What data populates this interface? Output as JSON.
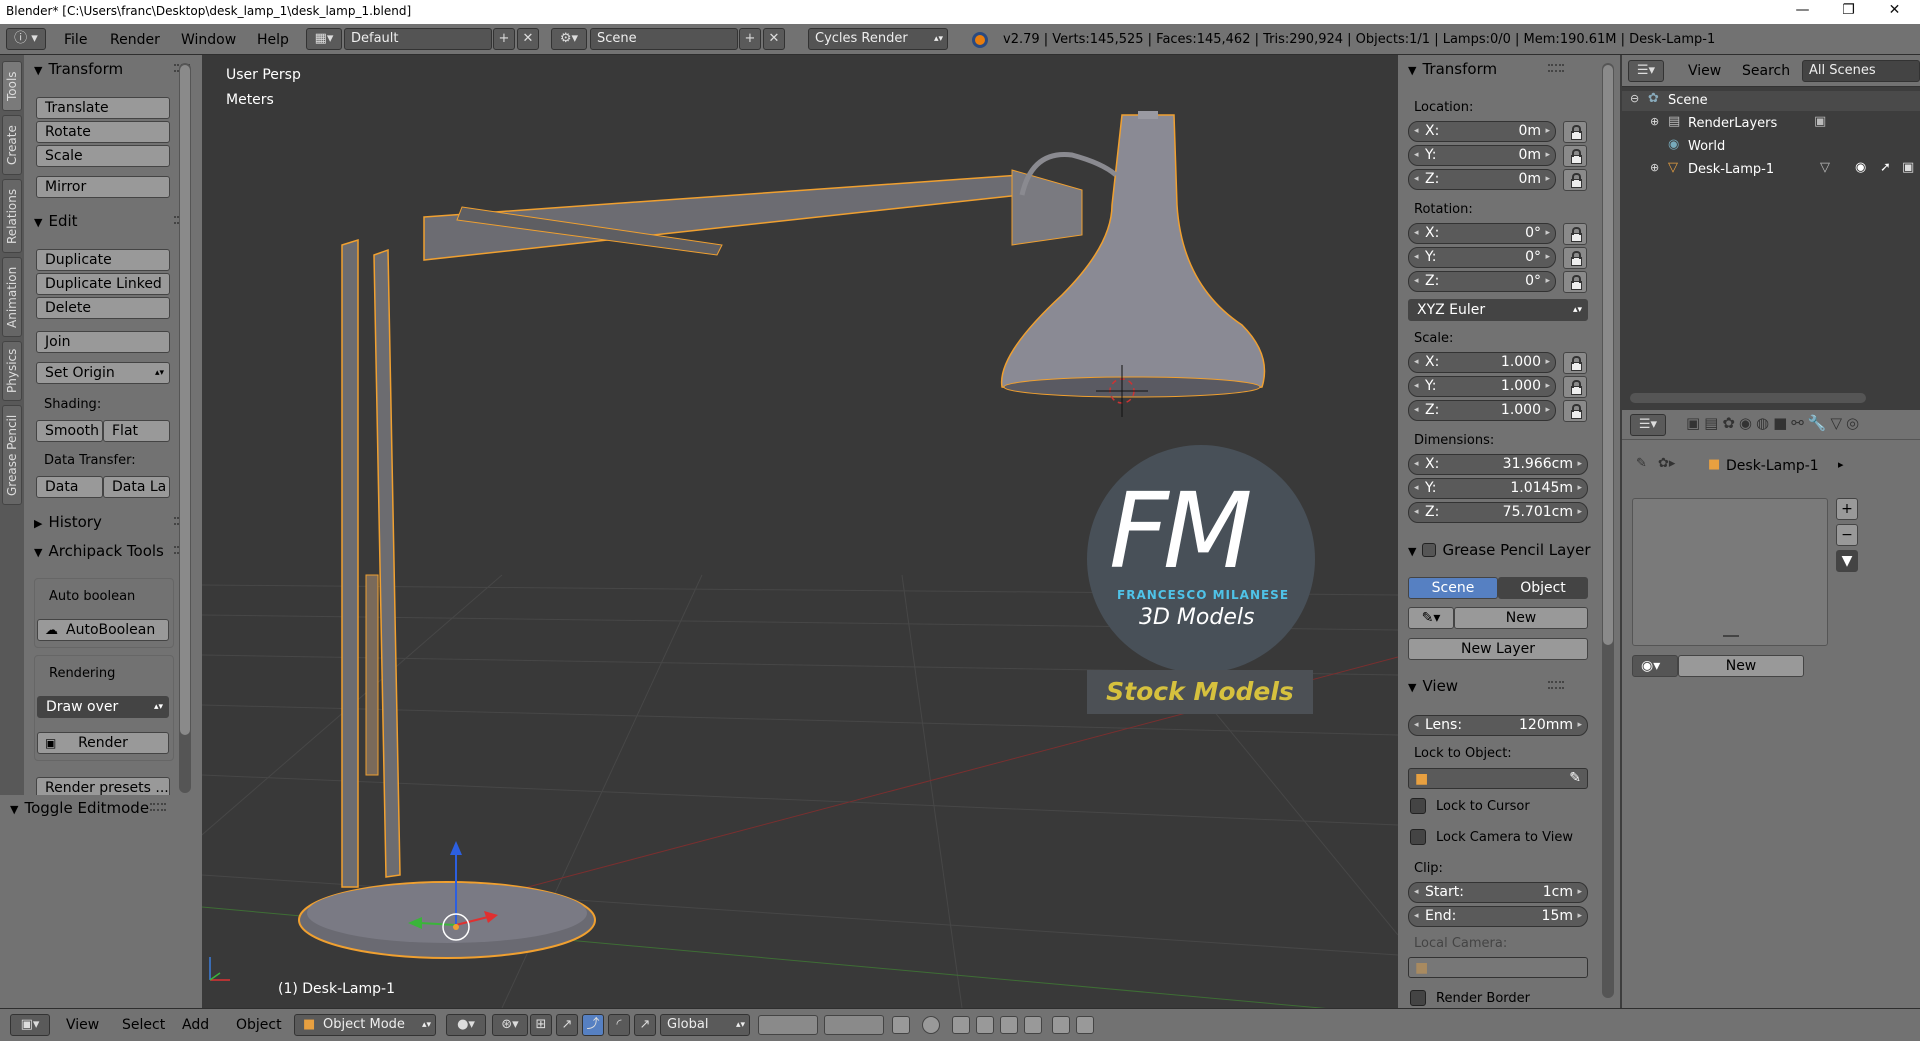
{
  "window": {
    "title": "Blender* [C:\\Users\\franc\\Desktop\\desk_lamp_1\\desk_lamp_1.blend]",
    "minimize": "—",
    "maximize": "❐",
    "close": "✕"
  },
  "infobar": {
    "menus": [
      "File",
      "Render",
      "Window",
      "Help"
    ],
    "layout": "Default",
    "scene": "Scene",
    "engine": "Cycles Render",
    "stats": "v2.79 | Verts:145,525 | Faces:145,462 | Tris:290,924 | Objects:1/1 | Lamps:0/0 | Mem:190.61M | Desk-Lamp-1"
  },
  "toolshelf": {
    "tabs": [
      "Tools",
      "Create",
      "Relations",
      "Animation",
      "Physics",
      "Grease Pencil"
    ],
    "transform": {
      "title": "Transform",
      "translate": "Translate",
      "rotate": "Rotate",
      "scale": "Scale",
      "mirror": "Mirror"
    },
    "edit": {
      "title": "Edit",
      "duplicate": "Duplicate",
      "duplicate_linked": "Duplicate Linked",
      "delete": "Delete",
      "join": "Join",
      "set_origin": "Set Origin",
      "shading_label": "Shading:",
      "smooth": "Smooth",
      "flat": "Flat",
      "data_transfer_label": "Data Transfer:",
      "data": "Data",
      "data_la": "Data La"
    },
    "history": "History",
    "archipack": {
      "title": "Archipack Tools",
      "auto_boolean_label": "Auto boolean",
      "auto_boolean_btn": "AutoBoolean",
      "rendering_label": "Rendering",
      "draw_over": "Draw over",
      "render": "Render",
      "render_presets": "Render presets ..."
    },
    "toggle_editmode": "Toggle Editmode"
  },
  "viewport": {
    "view_name": "User Persp",
    "units": "Meters",
    "object_label": "(1) Desk-Lamp-1",
    "watermark": {
      "letters": "FM",
      "name": "FRANCESCO MILANESE",
      "sub": "3D Models",
      "banner": "Stock Models"
    }
  },
  "npanel": {
    "transform_title": "Transform",
    "location_label": "Location:",
    "location": [
      {
        "axis": "X:",
        "value": "0m"
      },
      {
        "axis": "Y:",
        "value": "0m"
      },
      {
        "axis": "Z:",
        "value": "0m"
      }
    ],
    "rotation_label": "Rotation:",
    "rotation": [
      {
        "axis": "X:",
        "value": "0°"
      },
      {
        "axis": "Y:",
        "value": "0°"
      },
      {
        "axis": "Z:",
        "value": "0°"
      }
    ],
    "rotation_mode": "XYZ Euler",
    "scale_label": "Scale:",
    "scale": [
      {
        "axis": "X:",
        "value": "1.000"
      },
      {
        "axis": "Y:",
        "value": "1.000"
      },
      {
        "axis": "Z:",
        "value": "1.000"
      }
    ],
    "dimensions_label": "Dimensions:",
    "dimensions": [
      {
        "axis": "X:",
        "value": "31.966cm"
      },
      {
        "axis": "Y:",
        "value": "1.0145m"
      },
      {
        "axis": "Z:",
        "value": "75.701cm"
      }
    ],
    "grease_title": "Grease Pencil Layer",
    "gp_scene": "Scene",
    "gp_object": "Object",
    "gp_new": "New",
    "gp_new_layer": "New Layer",
    "view_title": "View",
    "lens_label": "Lens:",
    "lens_value": "120mm",
    "lock_to_object": "Lock to Object:",
    "lock_to_cursor": "Lock to Cursor",
    "lock_camera": "Lock Camera to View",
    "clip_label": "Clip:",
    "clip_start_label": "Start:",
    "clip_start": "1cm",
    "clip_end_label": "End:",
    "clip_end": "15m",
    "local_camera": "Local Camera:",
    "render_border": "Render Border"
  },
  "outliner": {
    "view": "View",
    "search": "Search",
    "filter": "All Scenes",
    "items": [
      "Scene",
      "RenderLayers",
      "World",
      "Desk-Lamp-1"
    ]
  },
  "properties": {
    "breadcrumb": "Desk-Lamp-1",
    "new": "New"
  },
  "bottombar": {
    "menus": [
      "View",
      "Select",
      "Add",
      "Object"
    ],
    "mode": "Object Mode",
    "orientation": "Global"
  },
  "colors": {
    "panel": "#727272",
    "viewport": "#393939",
    "accent_blue": "#5680c2",
    "selection_orange": "#f0a030"
  }
}
